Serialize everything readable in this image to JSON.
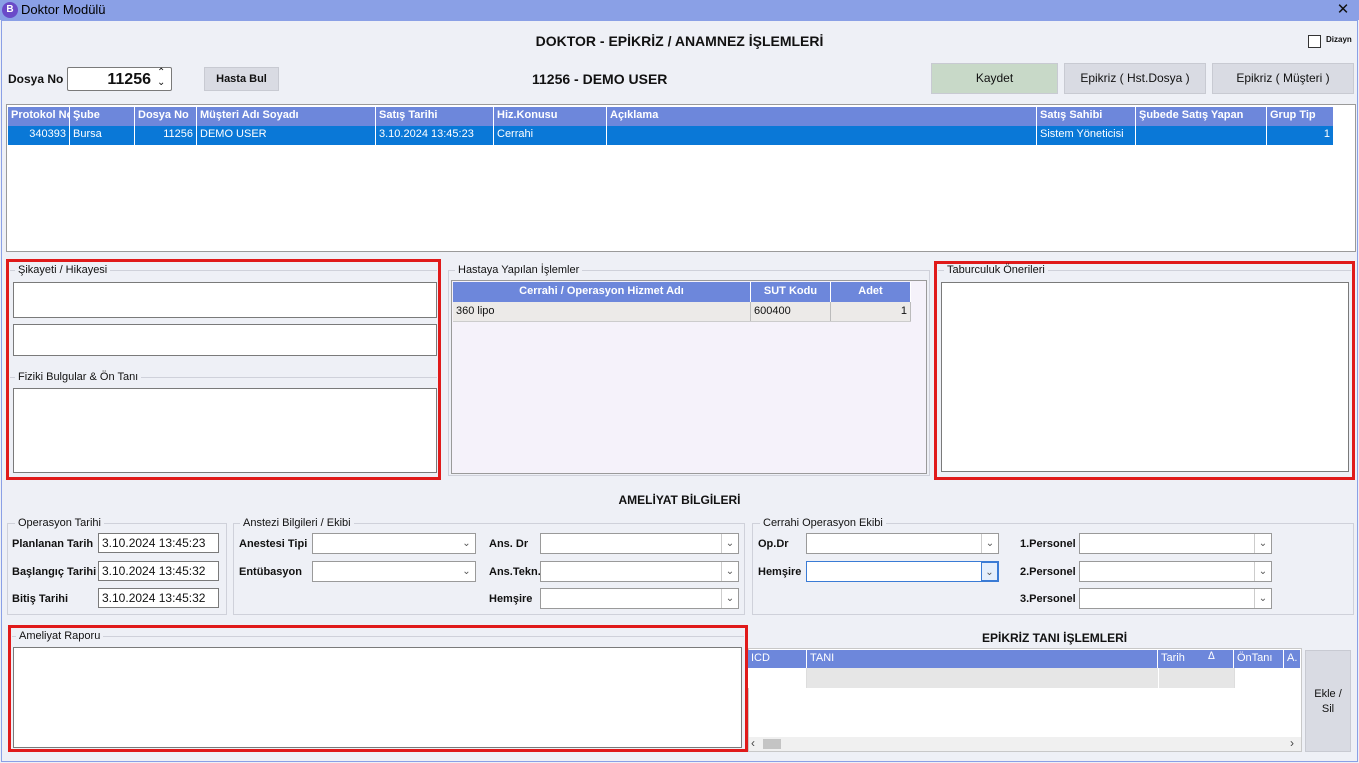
{
  "window": {
    "title": "Doktor Modülü",
    "close": "✕",
    "app_icon": "B"
  },
  "header": {
    "title": "DOKTOR - EPİKRİZ / ANAMNEZ İŞLEMLERİ",
    "dizayn_label": "Dizayn"
  },
  "patient": {
    "dosya_label": "Dosya No",
    "dosya_value": "11256",
    "hasta_bul": "Hasta Bul",
    "display": "11256  -  DEMO USER"
  },
  "actions": {
    "kaydet": "Kaydet",
    "epikriz_hst": "Epikriz ( Hst.Dosya )",
    "epikriz_musteri": "Epikriz ( Müşteri )"
  },
  "sales_grid": {
    "columns": [
      "Protokol No",
      "Şube",
      "Dosya No",
      "Müşteri Adı Soyadı",
      "Satış Tarihi",
      "Hiz.Konusu",
      "Açıklama",
      "Satış Sahibi",
      "Şubede Satış Yapan",
      "Grup Tip"
    ],
    "rows": [
      [
        "340393",
        "Bursa",
        "11256",
        "DEMO USER",
        "3.10.2024 13:45:23",
        "Cerrahi",
        "",
        "Sistem Yöneticisi",
        "",
        "1"
      ]
    ]
  },
  "sikayet": {
    "title": "Şikayeti / Hikayesi"
  },
  "fiziki": {
    "title": "Fiziki Bulgular  & Ön Tanı"
  },
  "islemler": {
    "title": "Hastaya Yapılan İşlemler",
    "columns": [
      "Cerrahi / Operasyon Hizmet Adı",
      "SUT Kodu",
      "Adet"
    ],
    "rows": [
      [
        "360 lipo",
        "600400",
        "1"
      ]
    ]
  },
  "taburculuk": {
    "title": "Taburculuk Önerileri"
  },
  "ameliyat": {
    "title": "AMELİYAT BİLGİLERİ"
  },
  "op_tarihi": {
    "title": "Operasyon Tarihi",
    "planlanan_label": "Planlanan Tarih",
    "planlanan": "3.10.2024 13:45:23",
    "baslangic_label": "Başlangıç Tarihi",
    "baslangic": "3.10.2024 13:45:32",
    "bitis_label": "Bitiş Tarihi",
    "bitis": "3.10.2024 13:45:32"
  },
  "anestezi": {
    "title": "Anstezi Bilgileri / Ekibi",
    "tipi_label": "Anestesi Tipi",
    "entubasyon_label": "Entübasyon",
    "ans_dr_label": "Ans. Dr",
    "ans_tekn_label": "Ans.Tekn.",
    "hemsire_label": "Hemşire"
  },
  "cerrahi_ekip": {
    "title": "Cerrahi Operasyon Ekibi",
    "opdr_label": "Op.Dr",
    "hemsire_label": "Hemşire",
    "p1_label": "1.Personel",
    "p2_label": "2.Personel",
    "p3_label": "3.Personel"
  },
  "rapor": {
    "title": "Ameliyat Raporu"
  },
  "tani": {
    "title": "EPİKRİZ TANI İŞLEMLERİ",
    "columns": [
      "ICD",
      "TANI",
      "Tarih",
      "ÖnTanı",
      "A."
    ],
    "ekle_sil": "Ekle / Sil"
  },
  "colors": {
    "titlebar": "#8aa0e6",
    "grid_header": "#6d87db",
    "selected_row": "#0a78d7",
    "highlight": "#e01a1a",
    "kaydet": "#c8d9c8"
  }
}
